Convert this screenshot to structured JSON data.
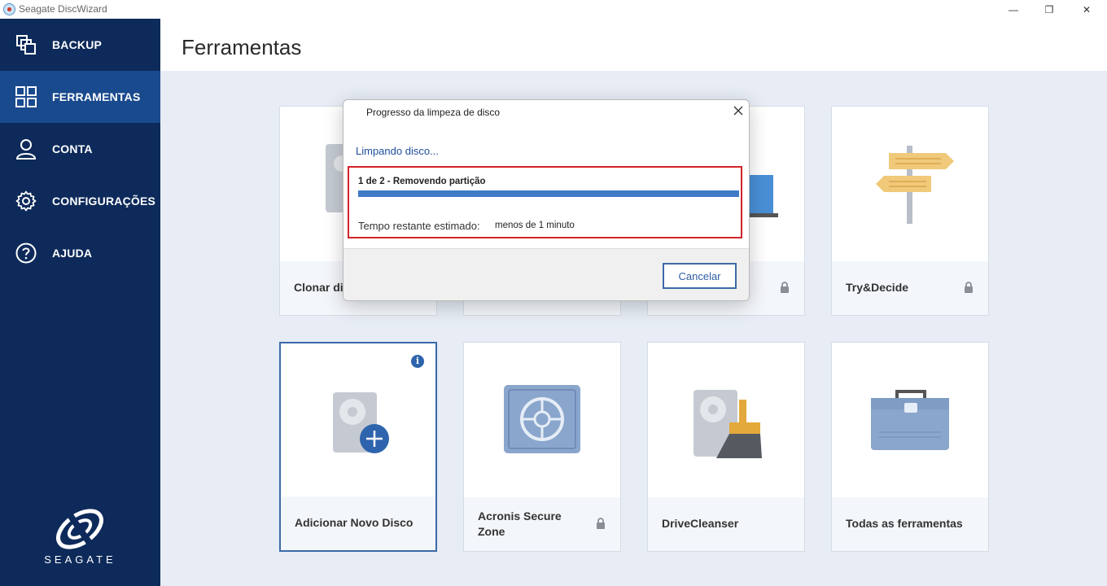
{
  "window": {
    "title": "Seagate DiscWizard",
    "minimize": "—",
    "maximize": "❐",
    "close": "✕"
  },
  "sidebar": {
    "items": [
      {
        "label": "BACKUP",
        "icon": "backup-icon"
      },
      {
        "label": "FERRAMENTAS",
        "icon": "tools-grid-icon",
        "active": true
      },
      {
        "label": "CONTA",
        "icon": "user-icon"
      },
      {
        "label": "CONFIGURAÇÕES",
        "icon": "gear-icon"
      },
      {
        "label": "AJUDA",
        "icon": "help-icon"
      }
    ],
    "logo_text": "SEAGATE"
  },
  "main": {
    "title": "Ferramentas",
    "cards": [
      {
        "label": "Clonar dis",
        "icon": "clone-disk-icon",
        "locked": false
      },
      {
        "label": "",
        "icon": "hidden-card-icon",
        "locked": false
      },
      {
        "label": "",
        "icon": "laptop-icon",
        "locked": true
      },
      {
        "label": "Try&Decide",
        "icon": "signpost-icon",
        "locked": true
      },
      {
        "label": "Adicionar Novo Disco",
        "icon": "add-disk-icon",
        "locked": false,
        "selected": true,
        "info": "i"
      },
      {
        "label": "Acronis Secure Zone",
        "icon": "safe-icon",
        "locked": true
      },
      {
        "label": "DriveCleanser",
        "icon": "drive-cleanser-icon",
        "locked": false
      },
      {
        "label": "Todas as ferramentas",
        "icon": "toolbox-icon",
        "locked": false
      }
    ]
  },
  "dialog": {
    "title": "Progresso da limpeza de disco",
    "status": "Limpando disco...",
    "step": "1 de 2 - Removendo partição",
    "progress": 1.0,
    "eta_label": "Tempo restante estimado:",
    "eta_value": "menos de 1 minuto",
    "cancel_label": "Cancelar"
  },
  "colors": {
    "sidebar_bg": "#0d2a5a",
    "sidebar_active": "#1a4a8e",
    "content_bg": "#e7ecf5",
    "progress_fill": "#3f7ac6",
    "highlight_border": "#d2232a",
    "accent": "#2e64ad"
  }
}
